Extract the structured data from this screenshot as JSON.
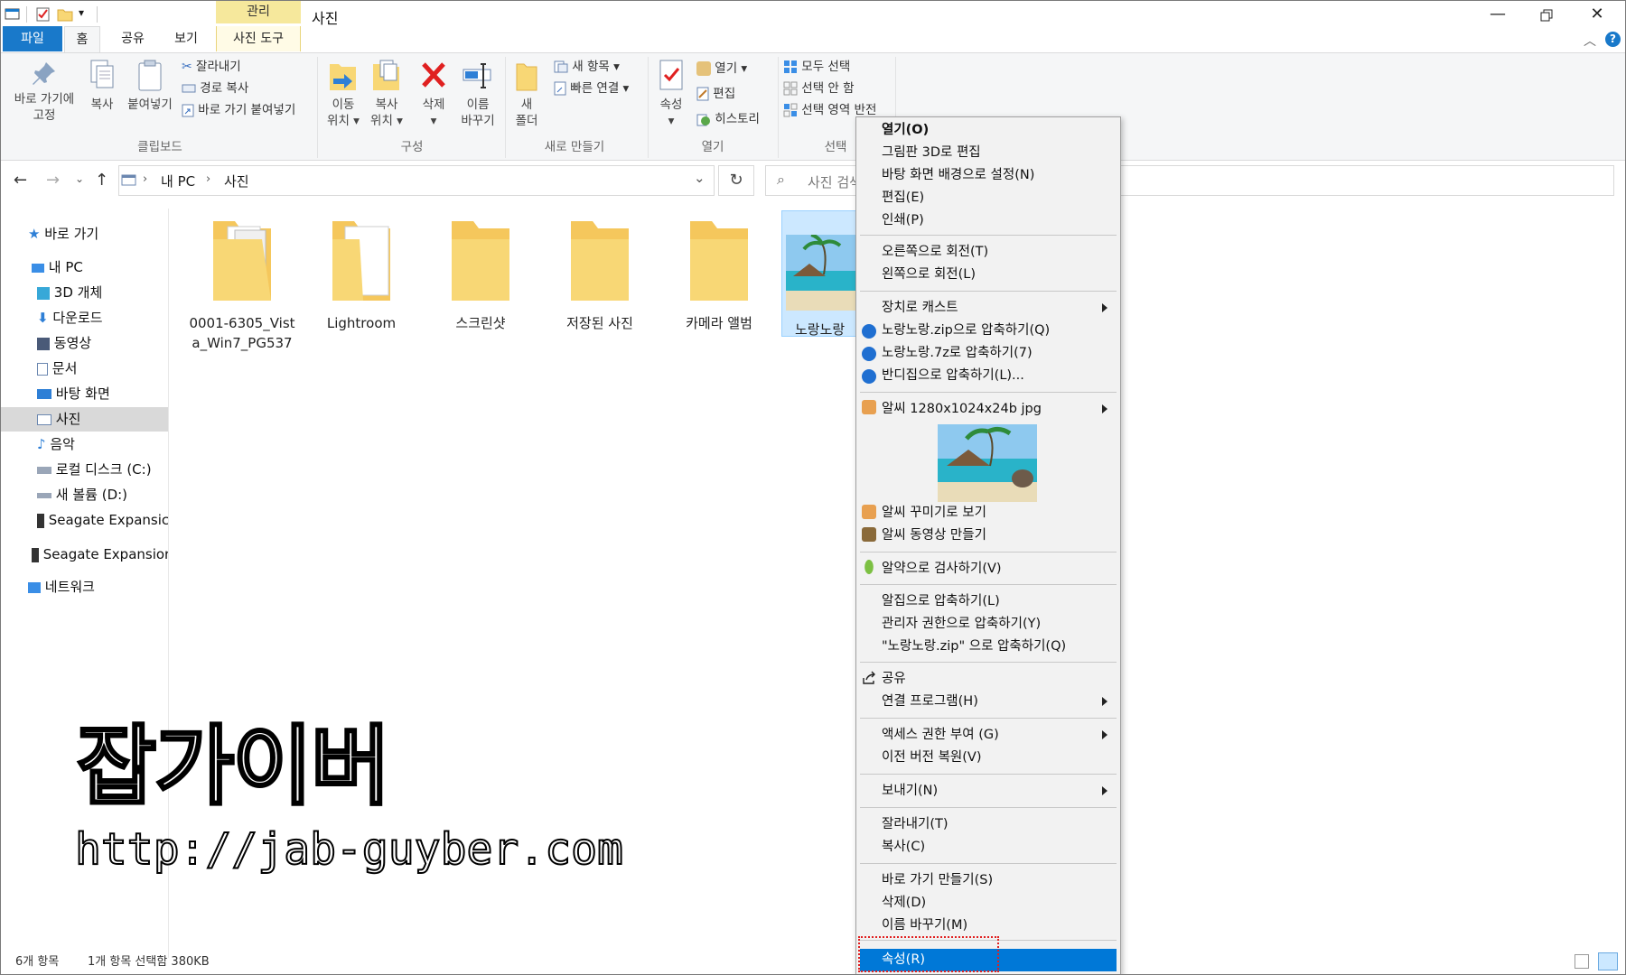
{
  "window": {
    "title": "사진",
    "context_tab_group": "관리",
    "min_icon": "minimize-icon",
    "max_icon": "restore-icon",
    "close_icon": "close-icon"
  },
  "tabs": {
    "file": "파일",
    "home": "홈",
    "share": "공유",
    "view": "보기",
    "picture_tools": "사진 도구"
  },
  "ribbon": {
    "clipboard": {
      "pin": "바로 가기에\n고정",
      "copy": "복사",
      "paste": "붙여넣기",
      "cut": "잘라내기",
      "copy_path": "경로 복사",
      "paste_shortcut": "바로 가기 붙여넣기",
      "label": "클립보드"
    },
    "organize": {
      "move_to": "이동\n위치 ▾",
      "copy_to": "복사\n위치 ▾",
      "delete": "삭제\n▾",
      "rename": "이름\n바꾸기",
      "label": "구성"
    },
    "new": {
      "new_folder": "새\n폴더",
      "new_item": "새 항목 ▾",
      "easy_access": "빠른 연결 ▾",
      "label": "새로 만들기"
    },
    "open": {
      "properties": "속성\n▾",
      "open": "열기 ▾",
      "edit": "편집",
      "history": "히스토리",
      "label": "열기"
    },
    "select": {
      "select_all": "모두 선택",
      "select_none": "선택 안 함",
      "invert": "선택 영역 반전",
      "label": "선택"
    }
  },
  "address": {
    "root": "내 PC",
    "current": "사진",
    "search_placeholder": "사진 검색"
  },
  "sidebar": {
    "quick_access": "바로 가기",
    "this_pc": "내 PC",
    "objects3d": "3D 개체",
    "downloads": "다운로드",
    "videos": "동영상",
    "documents": "문서",
    "desktop": "바탕 화면",
    "pictures": "사진",
    "music": "음악",
    "local_disk": "로컬 디스크 (C:)",
    "new_volume": "새 볼륨 (D:)",
    "seagate1": "Seagate Expansic",
    "seagate2": "Seagate Expansior",
    "network": "네트워크"
  },
  "files": [
    {
      "name": "0001-6305_Vista_Win7_PG537",
      "type": "folder"
    },
    {
      "name": "Lightroom",
      "type": "folder"
    },
    {
      "name": "스크린샷",
      "type": "folder"
    },
    {
      "name": "저장된 사진",
      "type": "folder"
    },
    {
      "name": "카메라 앨범",
      "type": "folder"
    },
    {
      "name": "노랑노랑",
      "type": "image",
      "selected": true
    }
  ],
  "context_menu": {
    "open": "열기(O)",
    "paint3d": "그림판 3D로 편집",
    "wallpaper": "바탕 화면 배경으로 설정(N)",
    "edit": "편집(E)",
    "print": "인쇄(P)",
    "rotate_right": "오른쪽으로 회전(T)",
    "rotate_left": "왼쪽으로 회전(L)",
    "cast": "장치로 캐스트",
    "zip": "노랑노랑.zip으로 압축하기(Q)",
    "sevenz": "노랑노랑.7z로 압축하기(7)",
    "bandizip": "반디집으로 압축하기(L)...",
    "alsee_info": "알씨 1280x1024x24b jpg",
    "alsee_decor": "알씨 꾸미기로 보기",
    "alsee_video": "알씨 동영상 만들기",
    "alyac": "알약으로 검사하기(V)",
    "alzip": "알집으로 압축하기(L)",
    "alzip_admin": "관리자 권한으로 압축하기(Y)",
    "alzip_named": "\"노랑노랑.zip\" 으로 압축하기(Q)",
    "share": "공유",
    "open_with": "연결 프로그램(H)",
    "give_access": "액세스 권한 부여 (G)",
    "restore": "이전 버전 복원(V)",
    "send_to": "보내기(N)",
    "cut": "잘라내기(T)",
    "copy": "복사(C)",
    "shortcut": "바로 가기 만들기(S)",
    "delete": "삭제(D)",
    "rename": "이름 바꾸기(M)",
    "properties": "속성(R)"
  },
  "watermark": {
    "title": "잡가이버",
    "url": "http://jab-guyber.com"
  },
  "status": {
    "count": "6개 항목",
    "selection": "1개 항목 선택함 380KB"
  },
  "colors": {
    "accent": "#0078d7",
    "file_tab": "#1979ca",
    "folder": "#f8d775",
    "highlight_dash": "#e02020"
  }
}
